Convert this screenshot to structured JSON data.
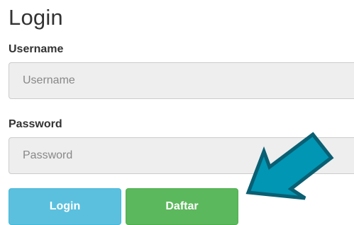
{
  "form": {
    "title": "Login",
    "username": {
      "label": "Username",
      "placeholder": "Username",
      "value": ""
    },
    "password": {
      "label": "Password",
      "placeholder": "Password",
      "value": ""
    },
    "buttons": {
      "login_label": "Login",
      "daftar_label": "Daftar"
    }
  },
  "colors": {
    "login_button": "#5bc0de",
    "daftar_button": "#5cb85c",
    "arrow_fill": "#0096b4",
    "arrow_stroke": "#0a5f73"
  },
  "annotation": {
    "icon": "arrow-pointer-icon"
  }
}
